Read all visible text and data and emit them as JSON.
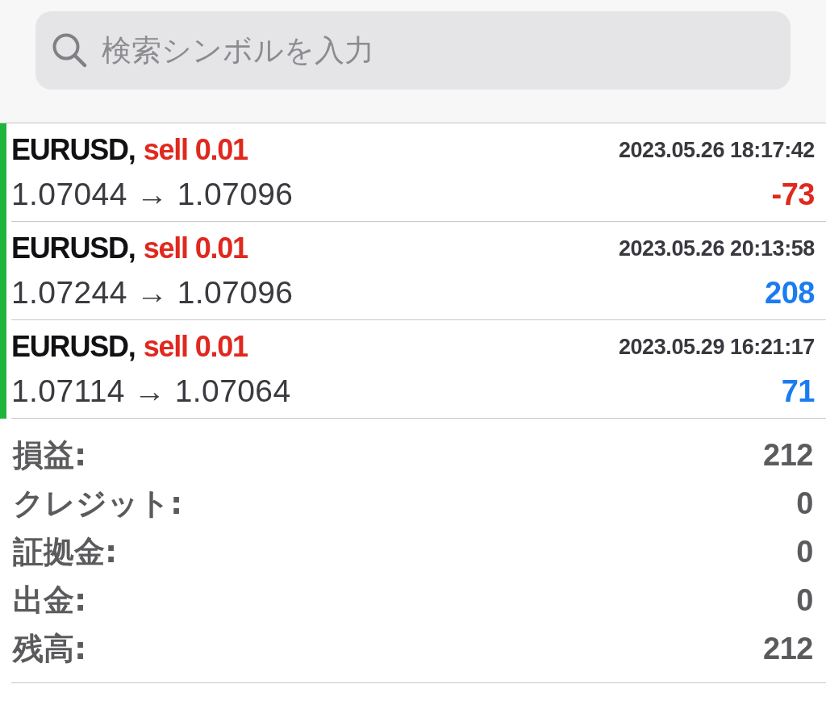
{
  "search": {
    "placeholder": "検索シンボルを入力"
  },
  "trades": [
    {
      "symbol": "EURUSD,",
      "order": "sell 0.01",
      "time": "2023.05.26 18:17:42",
      "prices": "1.07044 → 1.07096",
      "profit": "-73",
      "kind": "loss"
    },
    {
      "symbol": "EURUSD,",
      "order": "sell 0.01",
      "time": "2023.05.26 20:13:58",
      "prices": "1.07244 → 1.07096",
      "profit": "208",
      "kind": "gain"
    },
    {
      "symbol": "EURUSD,",
      "order": "sell 0.01",
      "time": "2023.05.29 16:21:17",
      "prices": "1.07114 → 1.07064",
      "profit": "71",
      "kind": "gain"
    }
  ],
  "summary": [
    {
      "label": "損益:",
      "value": "212"
    },
    {
      "label": "クレジット:",
      "value": "0"
    },
    {
      "label": "証拠金:",
      "value": "0"
    },
    {
      "label": "出金:",
      "value": "0"
    },
    {
      "label": "残高:",
      "value": "212"
    }
  ]
}
